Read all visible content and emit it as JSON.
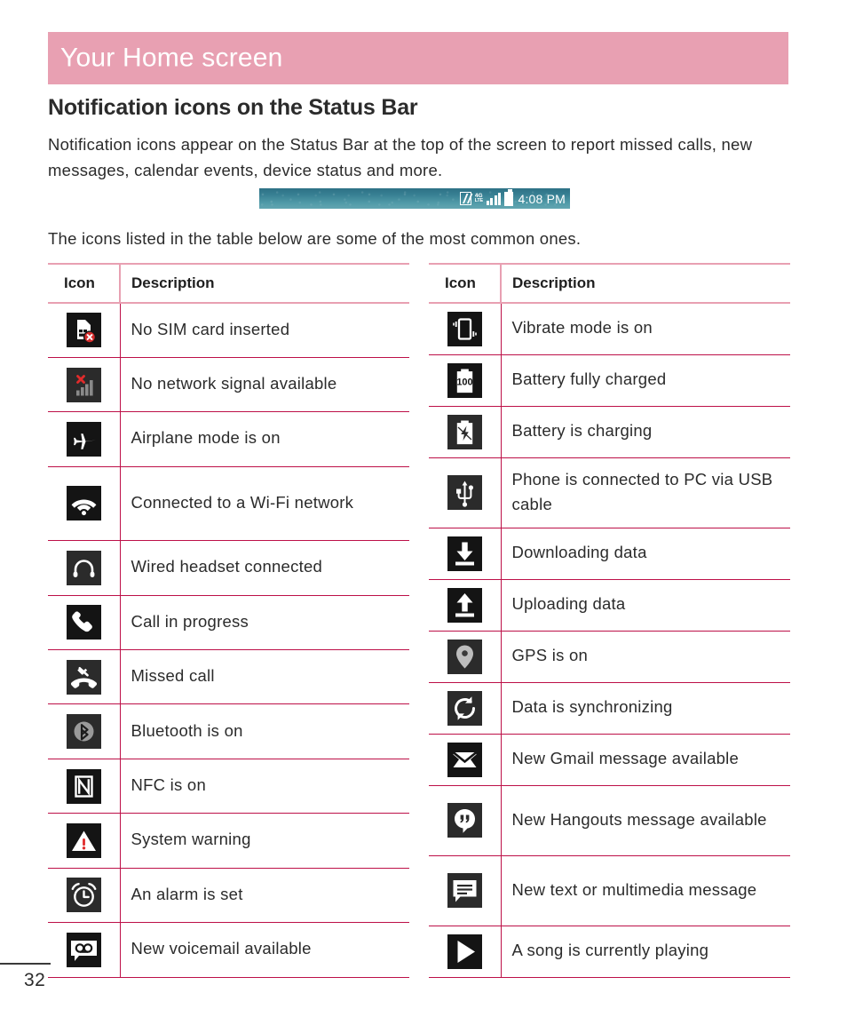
{
  "chapter": {
    "title": "Your Home screen",
    "band_color": "#e8a0b2"
  },
  "section": {
    "heading": "Notification icons on the Status Bar"
  },
  "paragraphs": {
    "intro": "Notification icons appear on the Status Bar at the top of the screen to report missed calls, new messages, calendar events, device status and more.",
    "list_note": "The icons listed in the table below are some of the most common ones."
  },
  "status_bar_figure": {
    "name": "android-status-bar-sample",
    "time": "4:08 PM",
    "icons": [
      "nfc-icon",
      "4g-lte-icon",
      "signal-bars-icon",
      "battery-full-icon"
    ],
    "lte_top": "4G",
    "lte_bottom": "LTE",
    "background_colors": [
      "#2d7186",
      "#63a6b1"
    ]
  },
  "table_theme": {
    "header_rule_color": "#e8a0b2",
    "row_rule_color": "#bd1048",
    "tile_color": "#141414"
  },
  "tables": [
    {
      "name": "left-icon-table",
      "headers": {
        "icon": "Icon",
        "description": "Description"
      },
      "rows": [
        {
          "icon": "no-sim-card-icon",
          "description": "No SIM card inserted"
        },
        {
          "icon": "no-signal-icon",
          "description": "No network signal available"
        },
        {
          "icon": "airplane-mode-icon",
          "description": "Airplane mode is on"
        },
        {
          "icon": "wifi-connected-icon",
          "description": "Connected to a Wi-Fi network",
          "tall": true
        },
        {
          "icon": "wired-headset-icon",
          "description": "Wired headset connected"
        },
        {
          "icon": "call-in-progress-icon",
          "description": "Call in progress"
        },
        {
          "icon": "missed-call-icon",
          "description": "Missed call"
        },
        {
          "icon": "bluetooth-icon",
          "description": "Bluetooth is on"
        },
        {
          "icon": "nfc-icon",
          "description": "NFC is on"
        },
        {
          "icon": "system-warning-icon",
          "description": "System warning"
        },
        {
          "icon": "alarm-clock-icon",
          "description": "An alarm is set"
        },
        {
          "icon": "voicemail-icon",
          "description": "New voicemail available"
        }
      ]
    },
    {
      "name": "right-icon-table",
      "headers": {
        "icon": "Icon",
        "description": "Description"
      },
      "rows": [
        {
          "icon": "vibrate-mode-icon",
          "description": "Vibrate mode is on"
        },
        {
          "icon": "battery-full-icon",
          "description": "Battery fully charged",
          "badge": "100"
        },
        {
          "icon": "battery-charging-icon",
          "description": "Battery is charging"
        },
        {
          "icon": "usb-connected-icon",
          "description": "Phone is connected to PC via USB cable",
          "tall": true
        },
        {
          "icon": "download-icon",
          "description": "Downloading data"
        },
        {
          "icon": "upload-icon",
          "description": "Uploading data"
        },
        {
          "icon": "gps-pin-icon",
          "description": "GPS is on"
        },
        {
          "icon": "sync-icon",
          "description": "Data is synchronizing"
        },
        {
          "icon": "gmail-icon",
          "description": "New Gmail message available"
        },
        {
          "icon": "hangouts-icon",
          "description": "New Hangouts message available",
          "tall": true
        },
        {
          "icon": "sms-message-icon",
          "description": "New text or multimedia message",
          "tall": true
        },
        {
          "icon": "music-playing-icon",
          "description": "A song is currently playing"
        }
      ]
    }
  ],
  "footer": {
    "page_number": "32"
  }
}
